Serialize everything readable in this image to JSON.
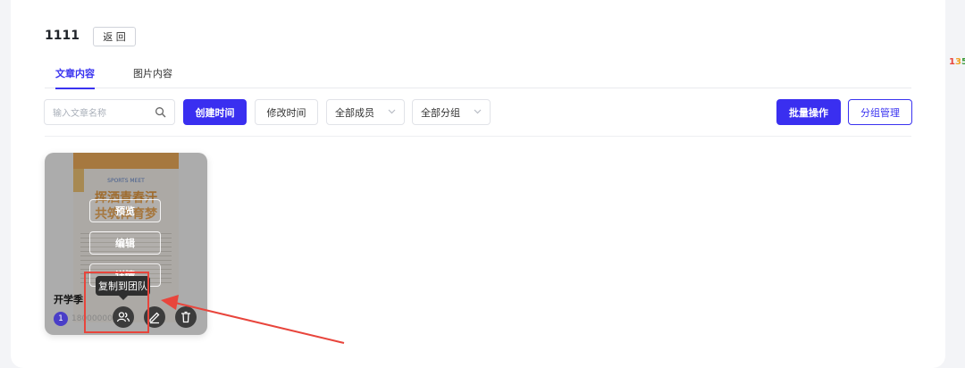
{
  "header": {
    "title": "1111",
    "back_label": "返 回"
  },
  "tabs": [
    {
      "label": "文章内容",
      "active": true
    },
    {
      "label": "图片内容",
      "active": false
    }
  ],
  "toolbar": {
    "search_placeholder": "输入文章名称",
    "sort_created": "创建时间",
    "sort_modified": "修改时间",
    "member_filter": "全部成员",
    "group_filter": "全部分组",
    "batch_label": "批量操作",
    "group_manage_label": "分组管理"
  },
  "card": {
    "poster": {
      "tag": "SPORTS MEET",
      "line1": "挥洒青春汗",
      "line2": "共筑体育梦"
    },
    "overlay_buttons": [
      "预览",
      "编辑",
      "详情"
    ],
    "title": "开学季",
    "owner_initial": "1",
    "owner_phone": "1800000000",
    "actions": [
      "team-icon",
      "edit-icon",
      "trash-icon"
    ]
  },
  "tooltip": {
    "label": "复制到团队"
  },
  "side_badge": "135",
  "colors": {
    "accent": "#3a2ff0",
    "annotation": "#e8453c"
  }
}
